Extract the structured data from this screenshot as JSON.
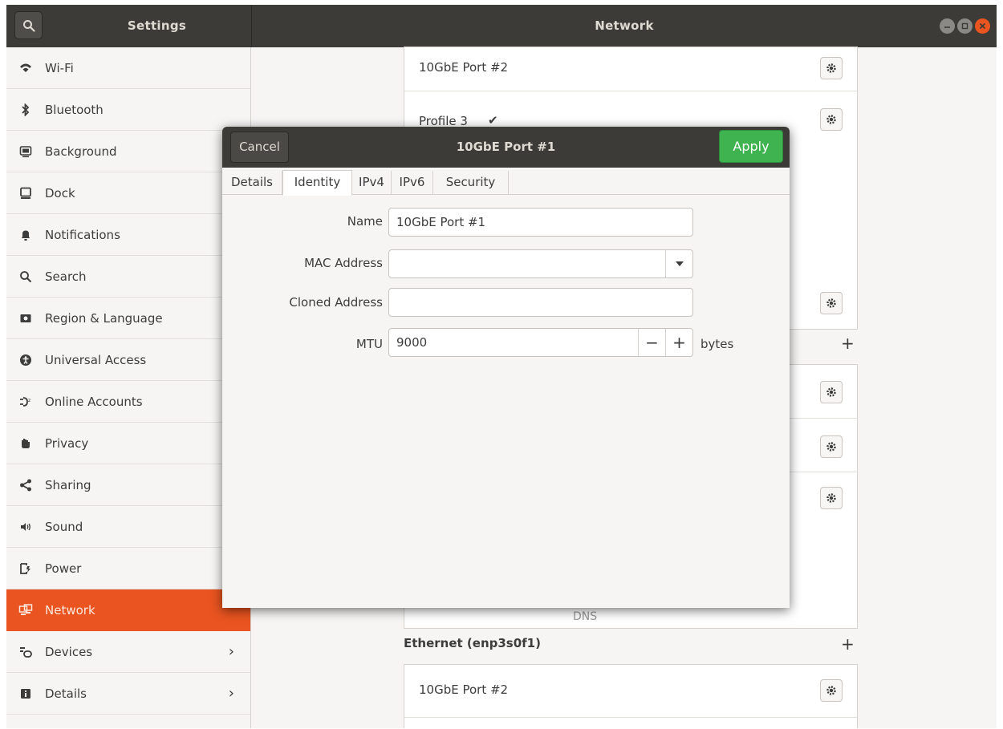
{
  "titlebar": {
    "app_title": "Settings",
    "page_title": "Network"
  },
  "sidebar": {
    "items": [
      {
        "label": "Wi-Fi",
        "icon": "wifi-icon"
      },
      {
        "label": "Bluetooth",
        "icon": "bluetooth-icon"
      },
      {
        "label": "Background",
        "icon": "background-icon"
      },
      {
        "label": "Dock",
        "icon": "dock-icon"
      },
      {
        "label": "Notifications",
        "icon": "bell-icon"
      },
      {
        "label": "Search",
        "icon": "search-icon"
      },
      {
        "label": "Region & Language",
        "icon": "region-icon"
      },
      {
        "label": "Universal Access",
        "icon": "universal-access-icon"
      },
      {
        "label": "Online Accounts",
        "icon": "online-accounts-icon"
      },
      {
        "label": "Privacy",
        "icon": "hand-icon"
      },
      {
        "label": "Sharing",
        "icon": "share-icon"
      },
      {
        "label": "Sound",
        "icon": "speaker-icon"
      },
      {
        "label": "Power",
        "icon": "power-icon"
      },
      {
        "label": "Network",
        "icon": "network-icon",
        "selected": true
      },
      {
        "label": "Devices",
        "icon": "devices-icon",
        "chevron": "›"
      },
      {
        "label": "Details",
        "icon": "info-icon",
        "chevron": "›"
      }
    ]
  },
  "main": {
    "profiles": [
      {
        "label": "10GbE Port #2"
      },
      {
        "label": "Profile 3",
        "checkmark": "✔"
      }
    ],
    "dns_label": "DNS",
    "section_title": "Ethernet (enp3s0f1)",
    "section_profile": "10GbE Port #2",
    "plus": "+"
  },
  "dialog": {
    "cancel": "Cancel",
    "title": "10GbE Port #1",
    "apply": "Apply",
    "tabs": [
      "Details",
      "Identity",
      "IPv4",
      "IPv6",
      "Security"
    ],
    "active_tab": "Identity",
    "fields": {
      "name_label": "Name",
      "name_value": "10GbE Port #1",
      "mac_label": "MAC Address",
      "mac_value": "",
      "cloned_label": "Cloned Address",
      "cloned_value": "",
      "mtu_label": "MTU",
      "mtu_value": "9000",
      "mtu_minus": "−",
      "mtu_plus": "+",
      "mtu_unit": "bytes"
    }
  },
  "colors": {
    "accent": "#e95420",
    "apply": "#3eb34f",
    "titlebar": "#3c3b37"
  }
}
